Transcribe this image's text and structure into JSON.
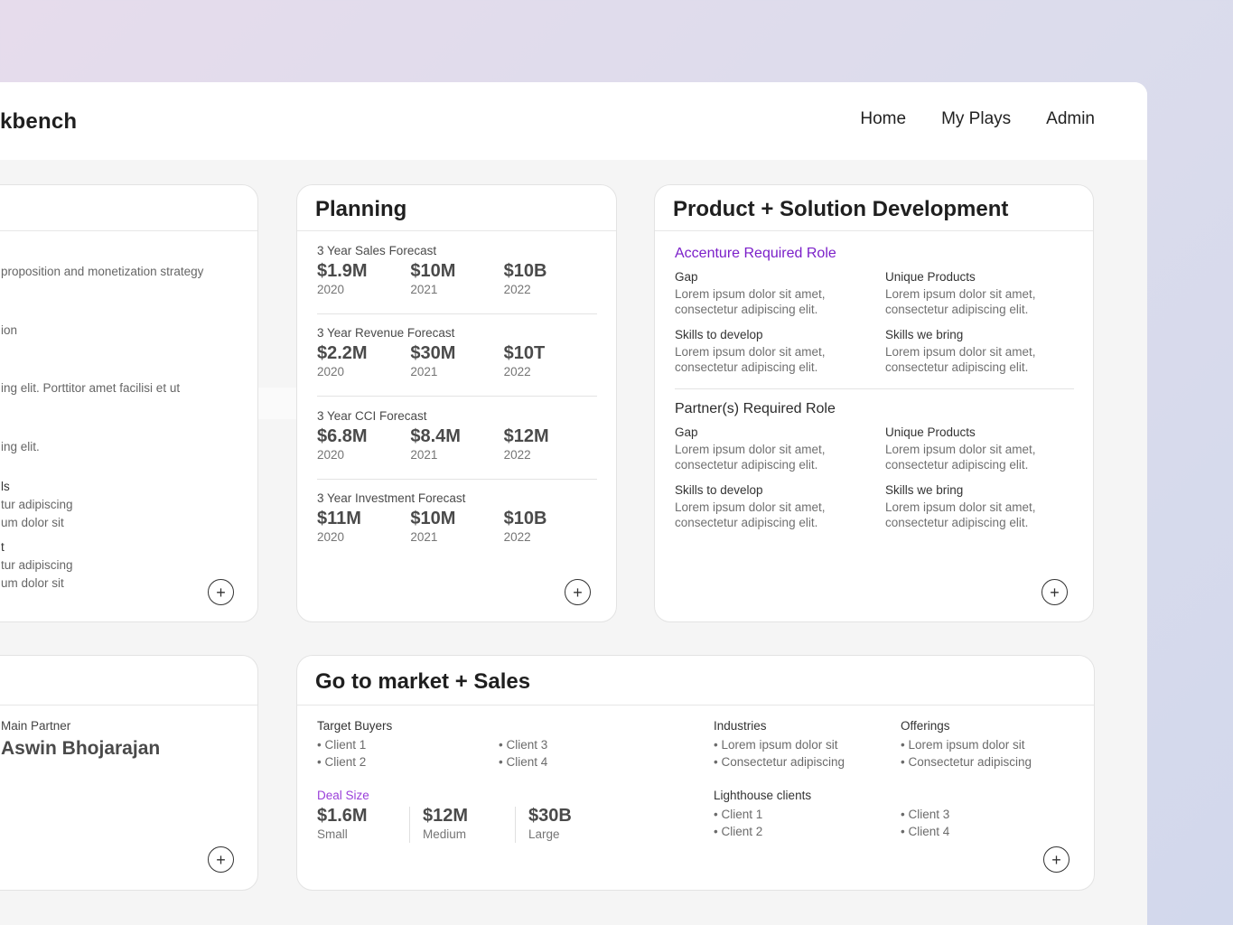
{
  "app": {
    "brand": "kbench"
  },
  "nav": [
    "Home",
    "My Plays",
    "Admin"
  ],
  "left_card": {
    "fragments": [
      "proposition and monetization strategy",
      "ion",
      "ing elit. Porttitor amet facilisi et ut",
      "ing elit.",
      "ls",
      "tur adipiscing",
      "um dolor sit",
      "t",
      "tur adipiscing",
      "um dolor sit"
    ]
  },
  "left_bottom_card": {
    "partner_label": "Main Partner",
    "partner_name": "Aswin Bhojarajan"
  },
  "planning": {
    "title": "Planning",
    "forecasts": [
      {
        "name": "3 Year Sales Forecast",
        "values": [
          "$1.9M",
          "$10M",
          "$10B"
        ],
        "years": [
          "2020",
          "2021",
          "2022"
        ]
      },
      {
        "name": "3 Year Revenue Forecast",
        "values": [
          "$2.2M",
          "$30M",
          "$10T"
        ],
        "years": [
          "2020",
          "2021",
          "2022"
        ]
      },
      {
        "name": "3 Year CCI Forecast",
        "values": [
          "$6.8M",
          "$8.4M",
          "$12M"
        ],
        "years": [
          "2020",
          "2021",
          "2022"
        ]
      },
      {
        "name": "3 Year Investment Forecast",
        "values": [
          "$11M",
          "$10M",
          "$10B"
        ],
        "years": [
          "2020",
          "2021",
          "2022"
        ]
      }
    ]
  },
  "product": {
    "title": "Product + Solution Development",
    "sections": [
      {
        "heading": "Accenture Required Role",
        "items": [
          {
            "label": "Gap",
            "text": "Lorem ipsum dolor sit amet,\nconsectetur adipiscing elit."
          },
          {
            "label": "Unique Products",
            "text": "Lorem ipsum dolor sit amet,\nconsectetur adipiscing elit."
          },
          {
            "label": "Skills to develop",
            "text": "Lorem ipsum dolor sit amet,\nconsectetur adipiscing elit."
          },
          {
            "label": "Skills we bring",
            "text": "Lorem ipsum dolor sit amet,\nconsectetur adipiscing elit."
          }
        ]
      },
      {
        "heading": "Partner(s) Required Role",
        "items": [
          {
            "label": "Gap",
            "text": "Lorem ipsum dolor sit amet,\nconsectetur adipiscing elit."
          },
          {
            "label": "Unique Products",
            "text": "Lorem ipsum dolor sit amet,\nconsectetur adipiscing elit."
          },
          {
            "label": "Skills to develop",
            "text": "Lorem ipsum dolor sit amet,\nconsectetur adipiscing elit."
          },
          {
            "label": "Skills we bring",
            "text": "Lorem ipsum dolor sit amet,\nconsectetur adipiscing elit."
          }
        ]
      }
    ]
  },
  "gtm": {
    "title": "Go to market + Sales",
    "target_buyers_label": "Target Buyers",
    "target_buyers": [
      "• Client 1",
      "• Client 2",
      "• Client 3",
      "• Client 4"
    ],
    "deal_size_label": "Deal Size",
    "deals": [
      {
        "value": "$1.6M",
        "caption": "Small"
      },
      {
        "value": "$12M",
        "caption": "Medium"
      },
      {
        "value": "$30B",
        "caption": "Large"
      }
    ],
    "industries_label": "Industries",
    "industries": [
      "• Lorem ipsum dolor sit",
      "• Consectetur adipiscing"
    ],
    "offerings_label": "Offerings",
    "offerings": [
      "• Lorem ipsum dolor sit",
      "• Consectetur adipiscing"
    ],
    "lighthouse_label": "Lighthouse clients",
    "lighthouse": [
      "• Client 1",
      "• Client 2",
      "• Client 3",
      "• Client 4"
    ]
  },
  "icons": {
    "add": "plus-circle-icon",
    "add_glyph": "+"
  }
}
